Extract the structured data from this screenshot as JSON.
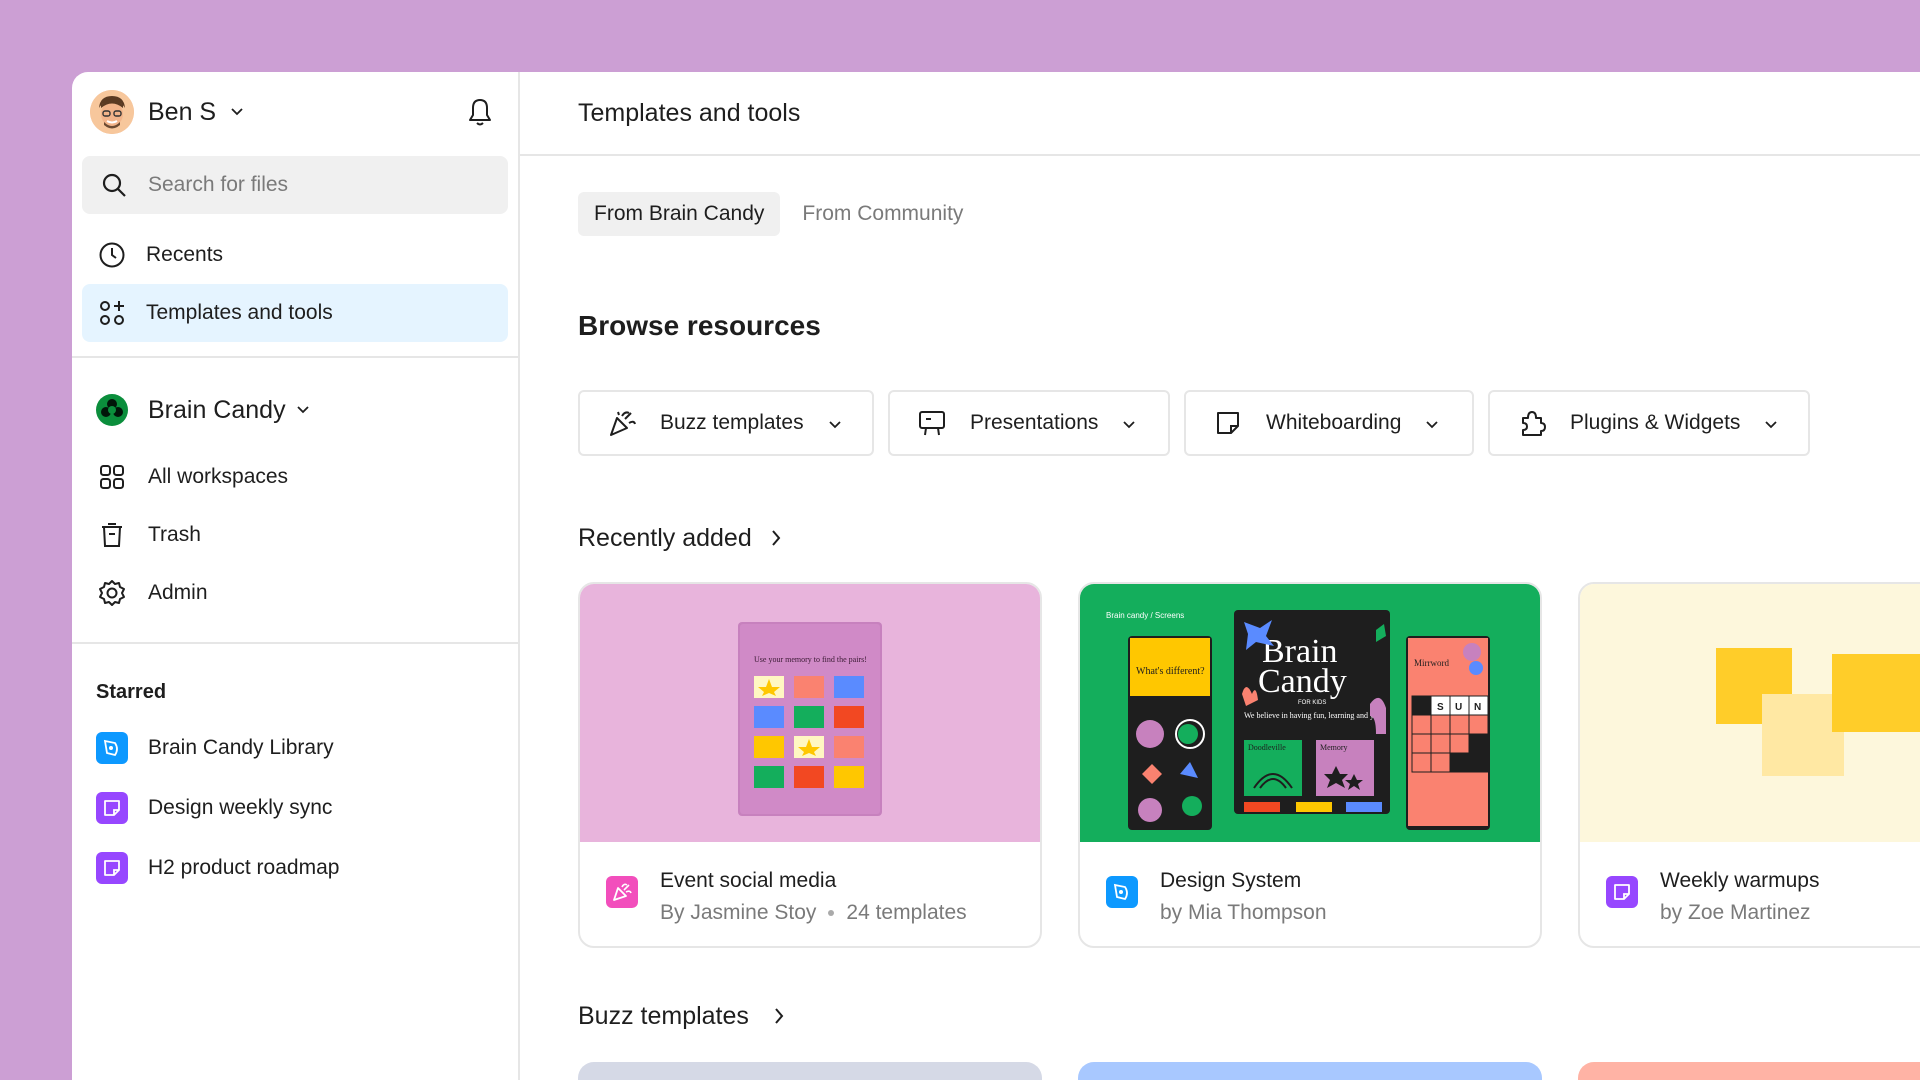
{
  "user": {
    "name": "Ben S"
  },
  "search": {
    "placeholder": "Search for files"
  },
  "nav": {
    "recents": "Recents",
    "templates": "Templates and tools"
  },
  "team": {
    "name": "Brain Candy",
    "items": [
      "All workspaces",
      "Trash",
      "Admin"
    ]
  },
  "starred": {
    "title": "Starred",
    "items": [
      "Brain Candy Library",
      "Design weekly sync",
      "H2 product roadmap"
    ]
  },
  "main": {
    "title": "Templates and tools",
    "tabs": [
      "From Brain Candy",
      "From Community"
    ],
    "browse_title": "Browse resources",
    "filters": [
      "Buzz templates",
      "Presentations",
      "Whiteboarding",
      "Plugins & Widgets"
    ],
    "recent_title": "Recently added",
    "buzz_title": "Buzz templates",
    "cards": [
      {
        "title": "Event social media",
        "author": "By Jasmine Stoy",
        "count": "24 templates"
      },
      {
        "title": "Design System",
        "author": "by Mia Thompson"
      },
      {
        "title": "Weekly warmups",
        "author": "by Zoe Martinez"
      }
    ]
  },
  "thumb_text": {
    "memory_title": "Use your memory to find the pairs!",
    "ds_header": "Brain candy / Screens",
    "ds_brain": "Brain",
    "ds_candy": "Candy",
    "ds_for_kids": "FOR KIDS",
    "ds_tagline": "We believe in having fun, learning and you!",
    "ds_whats_different": "What's different?",
    "ds_doodleville": "Doodleville",
    "ds_memory": "Memory",
    "ds_mirrword": "Mirrword",
    "ds_letters": [
      "S",
      "U",
      "N"
    ]
  },
  "colors": {
    "background": "#cc9fd4",
    "active_nav": "#e5f4ff",
    "buzz": "#f24ebc",
    "design": "#0d99ff",
    "figjam": "#9747ff",
    "team_logo": "#0b8e3c"
  }
}
